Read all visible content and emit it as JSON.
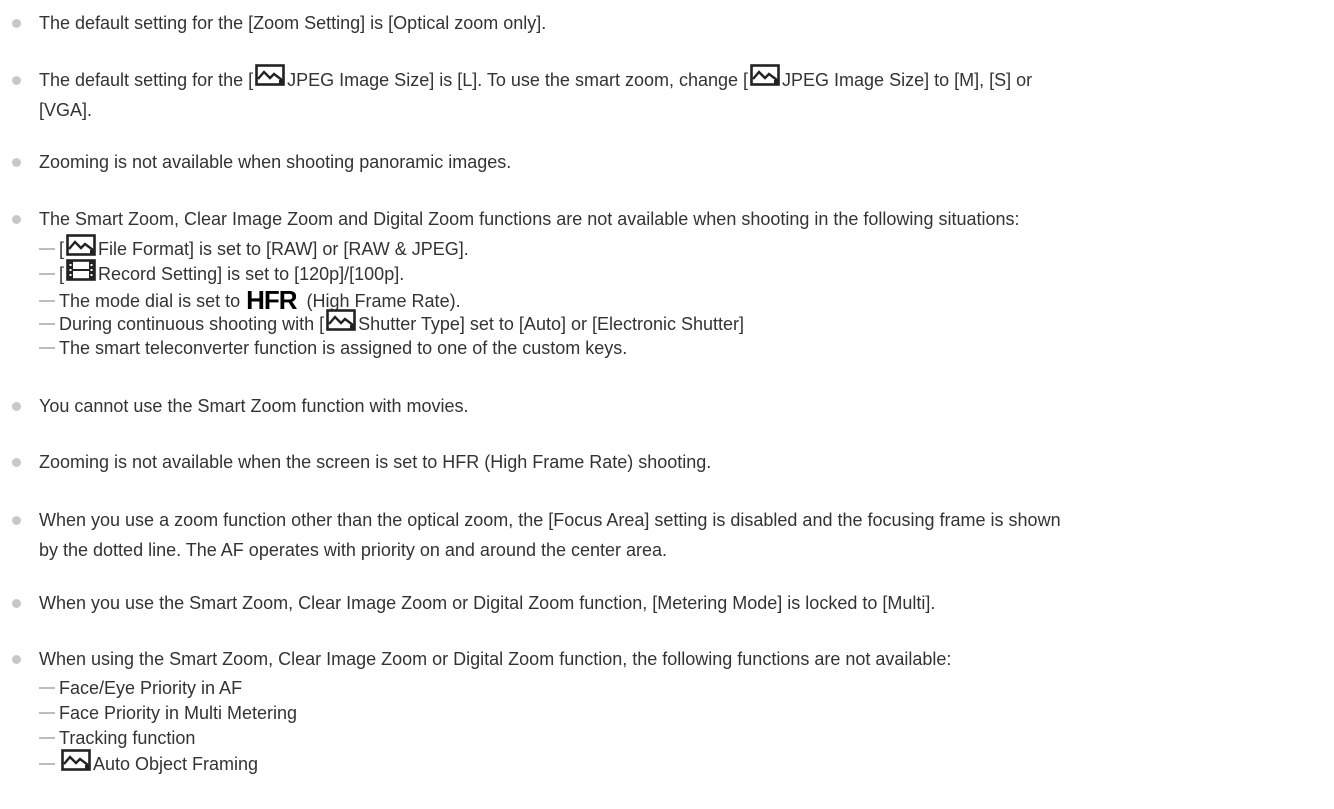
{
  "notes": [
    {
      "text": "The default setting for the [Zoom Setting] is [Optical zoom only]."
    },
    {
      "a": "The default setting for the [",
      "b": "JPEG Image Size] is [L]. To use the smart zoom, change [",
      "c": "JPEG Image Size] to [M], [S] or",
      "d": "[VGA]."
    },
    {
      "text": "Zooming is not available when shooting panoramic images."
    },
    {
      "text": "The Smart Zoom, Clear Image Zoom and Digital Zoom functions are not available when shooting in the following situations:",
      "subs": {
        "s1a": "[",
        "s1b": "File Format] is set to [RAW] or [RAW & JPEG].",
        "s2a": "[",
        "s2b": "Record Setting] is set to [120p]/[100p].",
        "s3a": "The mode dial is set to",
        "s3_hfr": "HFR",
        "s3b": "(High Frame Rate).",
        "s4a": "During continuous shooting with [",
        "s4b": "Shutter Type] set to [Auto] or [Electronic Shutter]",
        "s5": "The smart teleconverter function is assigned to one of the custom keys."
      }
    },
    {
      "text": "You cannot use the Smart Zoom function with movies."
    },
    {
      "text": "Zooming is not available when the screen is set to HFR (High Frame Rate) shooting."
    },
    {
      "line1": "When you use a zoom function other than the optical zoom, the [Focus Area] setting is disabled and the focusing frame is shown",
      "line2": "by the dotted line. The AF operates with priority on and around the center area."
    },
    {
      "text": "When you use the Smart Zoom, Clear Image Zoom or Digital Zoom function, [Metering Mode] is locked to [Multi]."
    },
    {
      "text": "When using the Smart Zoom, Clear Image Zoom or Digital Zoom function, the following functions are not available:",
      "subs": [
        "Face/Eye Priority in AF",
        "Face Priority in Multi Metering",
        "Tracking function",
        "Auto Object Framing"
      ]
    }
  ],
  "icons": {
    "still": "still-image-icon",
    "movie": "movie-icon",
    "hfr": "hfr-mode-icon"
  },
  "colors": {
    "text": "#333333",
    "bullet": "#c8c8c8",
    "dash": "#bdbdbd"
  }
}
